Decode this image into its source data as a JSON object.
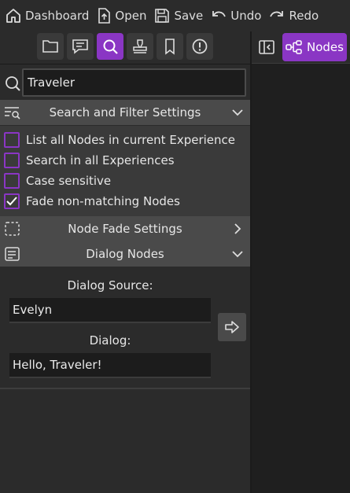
{
  "topbar": {
    "dashboard_label": "Dashboard",
    "open_label": "Open",
    "save_label": "Save",
    "undo_label": "Undo",
    "redo_label": "Redo"
  },
  "toolbar": {
    "tools": [
      "folder-icon",
      "comment-icon",
      "search-icon",
      "stamp-icon",
      "bookmark-icon",
      "alert-icon"
    ],
    "active_tool": "search-icon"
  },
  "right_panel": {
    "nodes_label": "Nodes"
  },
  "search": {
    "value": "Traveler"
  },
  "filter_settings": {
    "header": "Search and Filter Settings",
    "options": [
      {
        "label": "List all Nodes in current Experience",
        "checked": false
      },
      {
        "label": "Search in all Experiences",
        "checked": false
      },
      {
        "label": "Case sensitive",
        "checked": false
      },
      {
        "label": "Fade non-matching Nodes",
        "checked": true
      }
    ]
  },
  "fade_settings": {
    "header": "Node Fade Settings"
  },
  "dialog_nodes": {
    "header": "Dialog Nodes",
    "source_label": "Dialog Source:",
    "source_value": "Evelyn",
    "dialog_label": "Dialog:",
    "dialog_value": "Hello, Traveler!"
  },
  "colors": {
    "accent": "#8a36c4",
    "panel_bg": "#2b2b2b",
    "header_bg": "#4a4a4a"
  }
}
